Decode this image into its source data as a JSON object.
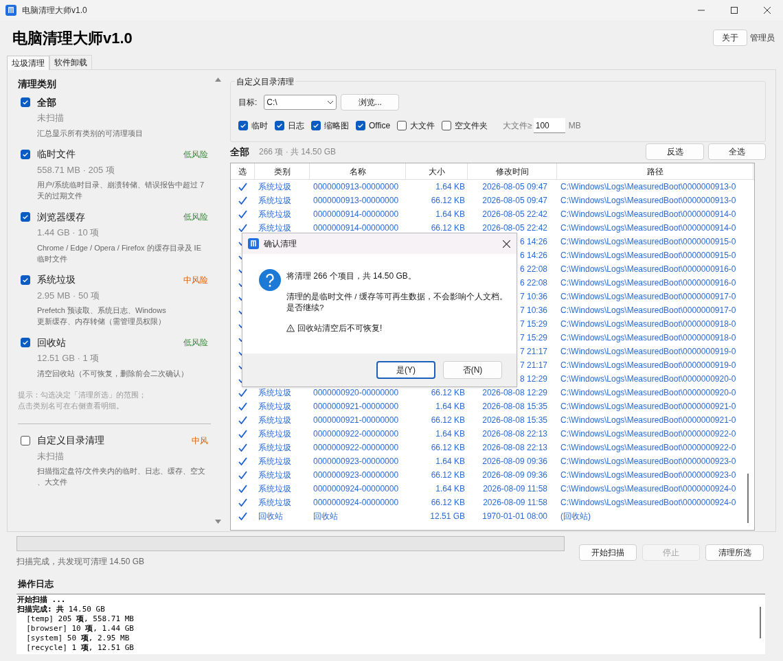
{
  "window": {
    "title": "电脑清理大师v1.0"
  },
  "header": {
    "title": "电脑清理大师v1.0",
    "about_button": "关于",
    "role": "管理员"
  },
  "tabs": [
    {
      "label": "垃圾清理",
      "selected": true
    },
    {
      "label": "软件卸载",
      "selected": false
    }
  ],
  "categories": {
    "heading": "清理类别",
    "items": [
      {
        "kind": "total",
        "name": "全部",
        "checked": true,
        "status": "未扫描",
        "desc": "汇总显示所有类别的可清理项目"
      },
      {
        "kind": "category",
        "name": "临时文件",
        "checked": true,
        "risk": "低风险",
        "color": "#3c8a3c",
        "status": "558.71 MB · 205 项",
        "desc": "用户/系统临时目录、崩溃转储、错误报告中超过 7\n天的过期文件"
      },
      {
        "kind": "category",
        "name": "浏览器缓存",
        "checked": true,
        "risk": "低风险",
        "color": "#3c8a3c",
        "status": "1.44 GB · 10 项",
        "desc": "Chrome / Edge / Opera / Firefox 的缓存目录及 IE\n临时文件"
      },
      {
        "kind": "category",
        "name": "系统垃圾",
        "checked": true,
        "risk": "中风险",
        "color": "#e0620a",
        "status": "2.95 MB · 50 项",
        "desc": "Prefetch 预读取、系统日志、Windows\n更新缓存、内存转储（需管理员权限）"
      },
      {
        "kind": "category",
        "name": "回收站",
        "checked": true,
        "risk": "低风险",
        "color": "#3c8a3c",
        "status": "12.51 GB · 1 项",
        "desc": "清空回收站（不可恢复，删除前会二次确认）"
      }
    ],
    "hint": "提示：勾选决定「清理所选」的范围；点击类别名可在右侧查看明细。",
    "custom": {
      "name": "自定义目录清理",
      "checked": false,
      "risk": "中风",
      "color": "#e0620a",
      "status": "未扫描",
      "desc": "扫描指定盘符/文件夹内的临时、日志、缓存、空文、大文件"
    }
  },
  "custom_dir": {
    "legend": "自定义目录清理",
    "target_label": "目标:",
    "target_value": "C:\\",
    "browse_button": "浏览...",
    "options": [
      {
        "label": "临时",
        "checked": true
      },
      {
        "label": "日志",
        "checked": true
      },
      {
        "label": "缩略图",
        "checked": true
      },
      {
        "label": "Office",
        "checked": true
      },
      {
        "label": "大文件",
        "checked": false
      },
      {
        "label": "空文件夹",
        "checked": false
      }
    ],
    "size_label": "大文件≥",
    "size_value": "100",
    "size_unit": "MB"
  },
  "list": {
    "title": "全部",
    "summary": "266 项 · 共 14.50 GB",
    "invert_button": "反选",
    "select_all_button": "全选",
    "columns": [
      "选",
      "类别",
      "名称",
      "大小",
      "修改时间",
      "路径"
    ],
    "rows": [
      {
        "checked": true,
        "category": "系统垃圾",
        "name": "0000000913-00000000",
        "size": "1.64 KB",
        "time": "2026-08-05 09:47",
        "path": "C:\\Windows\\Logs\\MeasuredBoot\\0000000913-0"
      },
      {
        "checked": true,
        "category": "系统垃圾",
        "name": "0000000913-00000000",
        "size": "66.12 KB",
        "time": "2026-08-05 09:47",
        "path": "C:\\Windows\\Logs\\MeasuredBoot\\0000000913-0"
      },
      {
        "checked": true,
        "category": "系统垃圾",
        "name": "0000000914-00000000",
        "size": "1.64 KB",
        "time": "2026-08-05 22:42",
        "path": "C:\\Windows\\Logs\\MeasuredBoot\\0000000914-0"
      },
      {
        "checked": true,
        "category": "系统垃圾",
        "name": "0000000914-00000000",
        "size": "66.12 KB",
        "time": "2026-08-05 22:42",
        "path": "C:\\Windows\\Logs\\MeasuredBoot\\0000000914-0"
      },
      {
        "checked": true,
        "time": "6 14:26",
        "path": "C:\\Windows\\Logs\\MeasuredBoot\\0000000915-0"
      },
      {
        "checked": true,
        "time": "6 14:26",
        "path": "C:\\Windows\\Logs\\MeasuredBoot\\0000000915-0"
      },
      {
        "checked": true,
        "time": "6 22:08",
        "path": "C:\\Windows\\Logs\\MeasuredBoot\\0000000916-0"
      },
      {
        "checked": true,
        "time": "6 22:08",
        "path": "C:\\Windows\\Logs\\MeasuredBoot\\0000000916-0"
      },
      {
        "checked": true,
        "time": "7 10:36",
        "path": "C:\\Windows\\Logs\\MeasuredBoot\\0000000917-0"
      },
      {
        "checked": true,
        "time": "7 10:36",
        "path": "C:\\Windows\\Logs\\MeasuredBoot\\0000000917-0"
      },
      {
        "checked": true,
        "time": "7 15:29",
        "path": "C:\\Windows\\Logs\\MeasuredBoot\\0000000918-0"
      },
      {
        "checked": true,
        "time": "7 15:29",
        "path": "C:\\Windows\\Logs\\MeasuredBoot\\0000000918-0"
      },
      {
        "checked": true,
        "time": "7 21:17",
        "path": "C:\\Windows\\Logs\\MeasuredBoot\\0000000919-0"
      },
      {
        "checked": true,
        "time": "7 21:17",
        "path": "C:\\Windows\\Logs\\MeasuredBoot\\0000000919-0"
      },
      {
        "checked": true,
        "time": "8 12:29",
        "path": "C:\\Windows\\Logs\\MeasuredBoot\\0000000920-0"
      },
      {
        "checked": true,
        "category": "系统垃圾",
        "name": "0000000920-00000000",
        "size": "66.12 KB",
        "time": "2026-08-08 12:29",
        "path": "C:\\Windows\\Logs\\MeasuredBoot\\0000000920-0"
      },
      {
        "checked": true,
        "category": "系统垃圾",
        "name": "0000000921-00000000",
        "size": "1.64 KB",
        "time": "2026-08-08 15:35",
        "path": "C:\\Windows\\Logs\\MeasuredBoot\\0000000921-0"
      },
      {
        "checked": true,
        "category": "系统垃圾",
        "name": "0000000921-00000000",
        "size": "66.12 KB",
        "time": "2026-08-08 15:35",
        "path": "C:\\Windows\\Logs\\MeasuredBoot\\0000000921-0"
      },
      {
        "checked": true,
        "category": "系统垃圾",
        "name": "0000000922-00000000",
        "size": "1.64 KB",
        "time": "2026-08-08 22:13",
        "path": "C:\\Windows\\Logs\\MeasuredBoot\\0000000922-0"
      },
      {
        "checked": true,
        "category": "系统垃圾",
        "name": "0000000922-00000000",
        "size": "66.12 KB",
        "time": "2026-08-08 22:13",
        "path": "C:\\Windows\\Logs\\MeasuredBoot\\0000000922-0"
      },
      {
        "checked": true,
        "category": "系统垃圾",
        "name": "0000000923-00000000",
        "size": "1.64 KB",
        "time": "2026-08-09 09:36",
        "path": "C:\\Windows\\Logs\\MeasuredBoot\\0000000923-0"
      },
      {
        "checked": true,
        "category": "系统垃圾",
        "name": "0000000923-00000000",
        "size": "66.12 KB",
        "time": "2026-08-09 09:36",
        "path": "C:\\Windows\\Logs\\MeasuredBoot\\0000000923-0"
      },
      {
        "checked": true,
        "category": "系统垃圾",
        "name": "0000000924-00000000",
        "size": "1.64 KB",
        "time": "2026-08-09 11:58",
        "path": "C:\\Windows\\Logs\\MeasuredBoot\\0000000924-0"
      },
      {
        "checked": true,
        "category": "系统垃圾",
        "name": "0000000924-00000000",
        "size": "66.12 KB",
        "time": "2026-08-09 11:58",
        "path": "C:\\Windows\\Logs\\MeasuredBoot\\0000000924-0"
      },
      {
        "checked": true,
        "category": "回收站",
        "name": "回收站",
        "size": "12.51 GB",
        "time": "1970-01-01 08:00",
        "path": "(回收站)"
      }
    ]
  },
  "progress": {
    "level": 0
  },
  "status": "扫描完成，共发现可清理 14.50 GB",
  "actions": [
    {
      "label": "开始扫描",
      "disabled": false
    },
    {
      "label": "停止",
      "disabled": true
    },
    {
      "label": "清理所选",
      "disabled": false
    }
  ],
  "log": {
    "heading": "操作日志",
    "lines": [
      "**开始扫描 ...**",
      "**扫描完成: 共** 14.50 GB",
      "  [temp] 205 **项**, 558.71 MB",
      "  [browser] 10 **项**, 1.44 GB",
      "  [system] 50 **项**, 2.95 MB",
      "  [recycle] 1 **项**, 12.51 GB"
    ]
  },
  "dialog": {
    "title": "确认清理",
    "message": "将清理 266 个项目，共 14.50 GB。",
    "detail": "清理的是临时文件 / 缓存等可再生数据，不会影响个人文档。是否继续?",
    "warning": "回收站清空后不可恢复!",
    "buttons": [
      {
        "label": "是(Y)",
        "default": true
      },
      {
        "label": "否(N)",
        "default": false
      }
    ]
  }
}
